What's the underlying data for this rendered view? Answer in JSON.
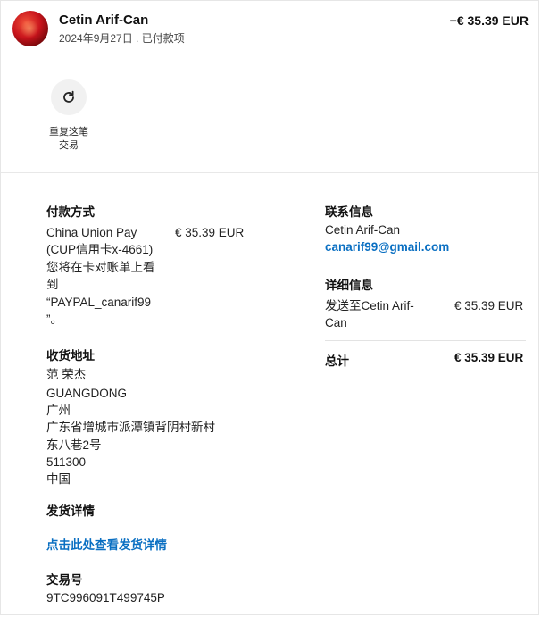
{
  "header": {
    "name": "Cetin Arif-Can",
    "date_status": "2024年9月27日 . 已付款项",
    "amount": "−€ 35.39 EUR"
  },
  "actions": {
    "repeat_label": "重复这笔交易"
  },
  "payment": {
    "title": "付款方式",
    "method_lines": [
      "China Union Pay",
      "(CUP信用卡x-4661)",
      "您将在卡对账单上看",
      "到",
      "“PAYPAL_canarif99",
      "”。"
    ],
    "amount": "€ 35.39 EUR"
  },
  "shipping_address": {
    "title": "收货地址",
    "lines": [
      "范 荣杰",
      "GUANGDONG",
      "广州",
      "广东省增城市派潭镇背阴村新村",
      "东八巷2号",
      "511300",
      "中国"
    ]
  },
  "shipping_details": {
    "title": "发货详情",
    "link": "点击此处查看发货详情"
  },
  "transaction": {
    "title": "交易号",
    "id": "9TC996091T499745P"
  },
  "contact": {
    "title": "联系信息",
    "name": "Cetin Arif-Can",
    "email": "canarif99@gmail.com"
  },
  "details": {
    "title": "详细信息",
    "sent_to_lines": [
      "发送至Cetin Arif-",
      "Can"
    ],
    "sent_amount": "€ 35.39 EUR",
    "total_label": "总计",
    "total_amount": "€ 35.39 EUR"
  },
  "icons": {
    "repeat": "refresh-icon"
  },
  "colors": {
    "link": "#0a6fc2",
    "text": "#1a1a1a"
  }
}
